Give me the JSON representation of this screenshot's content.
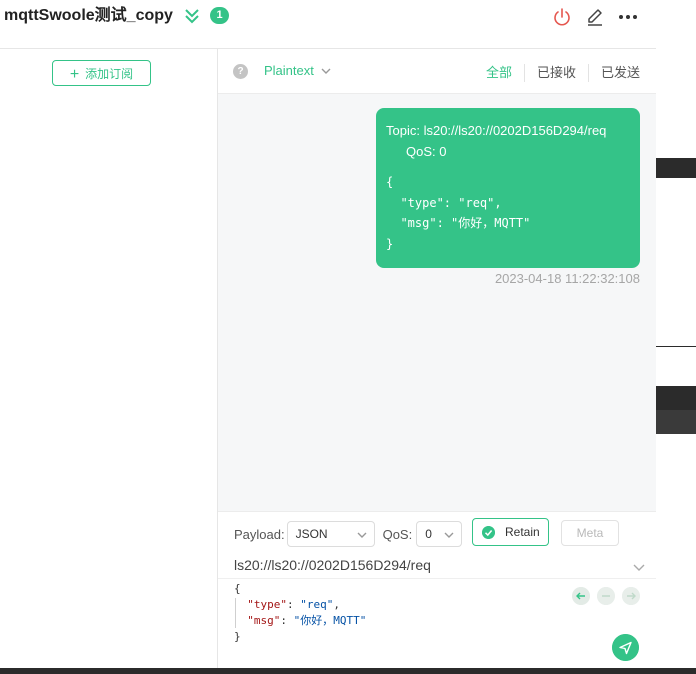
{
  "header": {
    "connection_name": "mqttSwoole测试_copy",
    "unread_count": "1"
  },
  "sidebar": {
    "add_subscription_label": "添加订阅"
  },
  "toolbar": {
    "payload_format": "Plaintext",
    "filters": [
      "全部",
      "已接收",
      "已发送"
    ],
    "active_filter": "全部"
  },
  "messages": [
    {
      "direction": "sent",
      "topic_line": "Topic: ls20://ls20://0202D156D294/req",
      "qos_line": "QoS: 0",
      "payload_lines": [
        "{",
        "  \"type\": \"req\",",
        "  \"msg\": \"你好，MQTT\"",
        "}"
      ],
      "time": "2023-04-18 11:22:32:108"
    }
  ],
  "composer": {
    "payload_label": "Payload:",
    "payload_type": "JSON",
    "qos_label": "QoS:",
    "qos_value": "0",
    "retain_label": "Retain",
    "meta_label": "Meta",
    "topic": "ls20://ls20://0202D156D294/req",
    "editor": {
      "open": "{",
      "type_key": "\"type\"",
      "type_val": "\"req\"",
      "msg_key": "\"msg\"",
      "msg_val": "\"你好，MQTT\"",
      "close": "}"
    }
  },
  "colors": {
    "accent": "#34c388",
    "disconnect": "#e5574f"
  }
}
